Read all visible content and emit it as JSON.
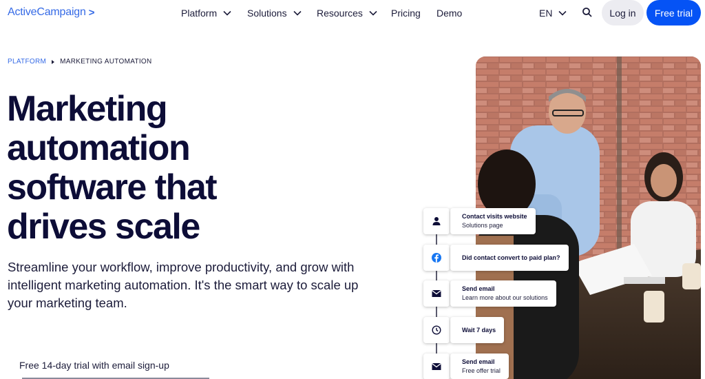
{
  "logo": {
    "text": "ActiveCampaign",
    "chevron": ">"
  },
  "nav": {
    "items": [
      {
        "label": "Platform",
        "dropdown": true
      },
      {
        "label": "Solutions",
        "dropdown": true
      },
      {
        "label": "Resources",
        "dropdown": true
      },
      {
        "label": "Pricing",
        "dropdown": false
      },
      {
        "label": "Demo",
        "dropdown": false
      }
    ],
    "language": "EN",
    "login_label": "Log in",
    "trial_label": "Free trial"
  },
  "breadcrumb": {
    "parent": "PLATFORM",
    "current": "MARKETING AUTOMATION"
  },
  "hero": {
    "headline_lines": [
      "Marketing",
      "automation",
      "software that",
      "drives scale"
    ],
    "subtext": "Streamline your workflow, improve productivity, and grow with intelligent marketing automation. It's the smart way to scale up your marketing team.",
    "trial_note": "Free 14-day trial with email sign-up"
  },
  "workflow": [
    {
      "icon": "user-icon",
      "title": "Contact visits website",
      "subtitle": "Solutions page"
    },
    {
      "icon": "facebook-icon",
      "title": "Did contact convert to paid plan?",
      "subtitle": ""
    },
    {
      "icon": "mail-icon",
      "title": "Send email",
      "subtitle": "Learn more about our solutions"
    },
    {
      "icon": "clock-icon",
      "title": "Wait 7 days",
      "subtitle": ""
    },
    {
      "icon": "mail-icon",
      "title": "Send email",
      "subtitle": "Free offer trial"
    }
  ],
  "colors": {
    "brand_blue": "#356ae6",
    "cta_blue": "#0553f5",
    "text_navy": "#0d0d37",
    "login_bg": "#ececf1"
  }
}
